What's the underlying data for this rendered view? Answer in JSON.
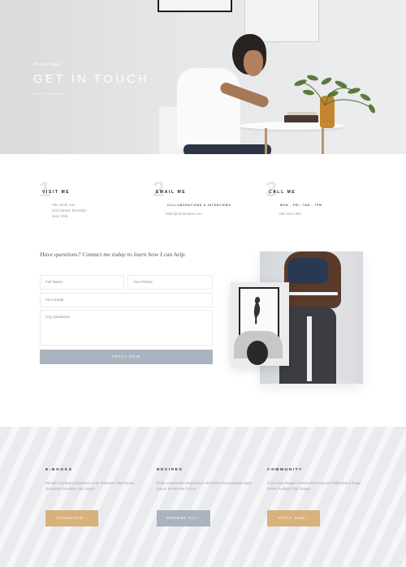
{
  "hero": {
    "eyebrow": "Pro Oss Tutcr",
    "title": "GET IN TOUCH",
    "breadcrumb": "HOME  /  CONTACT"
  },
  "contact": [
    {
      "number": "1",
      "heading": "VISIT ME",
      "lines": [
        "784 Work Ave",
        "Grid Street, Brooklyn",
        "New York"
      ]
    },
    {
      "number": "2",
      "heading": "EMAIL ME",
      "sub": "COLLABORATIONS & INTERVIEWS",
      "value": "hello@minimalist.com"
    },
    {
      "number": "3",
      "heading": "CALL ME",
      "sub": "MON - FRI: 7AM - 7PM",
      "value": "+88 4321 567"
    }
  ],
  "form": {
    "prompt": "Have questions? Contact me today to learn how I can help.",
    "full_name_placeholder": "Full Name",
    "phone_placeholder": "Your Phone",
    "email_placeholder": "Your Email",
    "questions_placeholder": "Any Questions",
    "submit_label": "APPLY NOW"
  },
  "resources": [
    {
      "title": "E-BOOKS",
      "desc": "Mensb Conduunt Impertere Ante Malenae Uiterminan Ducanum Pradetor Sec Uteyn",
      "button": "DOWNLOAD  ›",
      "color": "#d7b27c"
    },
    {
      "title": "RECIPES",
      "desc": "Nulla Consectete Bepulanus Memmim Proreviertam Eget Ipsum Prosts Ne Forum",
      "button": "BROWSE ALL  ›",
      "color": "#a9b4c0"
    },
    {
      "title": "COMMUNITY",
      "desc": "Cum Koporibagen Partes Rita Kopronl Hollicebnus Puge Fever Posbunt Oui Gaspe",
      "button": "APPLY NOW  ›",
      "color": "#d7b27c"
    }
  ]
}
